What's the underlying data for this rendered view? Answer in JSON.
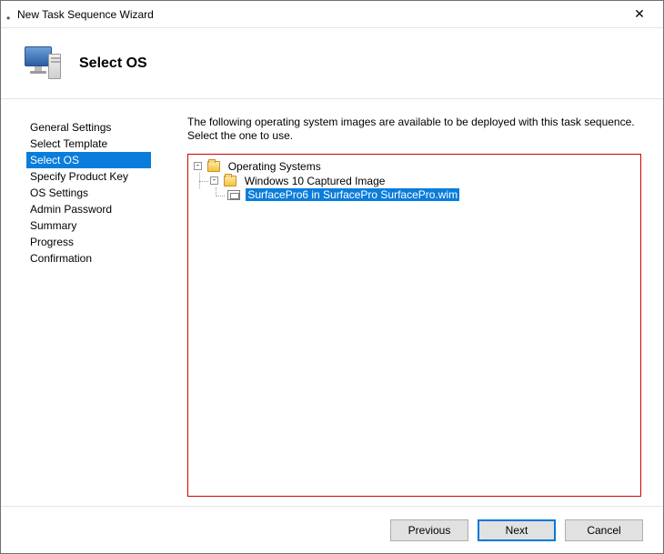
{
  "window": {
    "title": "New Task Sequence Wizard"
  },
  "header": {
    "title": "Select OS"
  },
  "sidebar": {
    "items": [
      {
        "label": "General Settings",
        "selected": false
      },
      {
        "label": "Select Template",
        "selected": false
      },
      {
        "label": "Select OS",
        "selected": true
      },
      {
        "label": "Specify Product Key",
        "selected": false
      },
      {
        "label": "OS Settings",
        "selected": false
      },
      {
        "label": "Admin Password",
        "selected": false
      },
      {
        "label": "Summary",
        "selected": false
      },
      {
        "label": "Progress",
        "selected": false
      },
      {
        "label": "Confirmation",
        "selected": false
      }
    ]
  },
  "main": {
    "instruction": "The following operating system images are available to be deployed with this task sequence.  Select the one to use.",
    "tree": {
      "root": {
        "label": "Operating Systems",
        "expanded": true,
        "children": [
          {
            "label": "Windows 10 Captured Image",
            "expanded": true,
            "children": [
              {
                "label": "SurfacePro6 in SurfacePro SurfacePro.wim",
                "selected": true
              }
            ]
          }
        ]
      }
    }
  },
  "footer": {
    "previous": "Previous",
    "next": "Next",
    "cancel": "Cancel"
  }
}
